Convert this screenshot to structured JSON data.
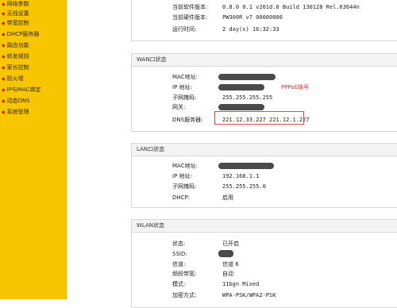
{
  "sidebar": {
    "items": [
      {
        "label": "网络参数"
      },
      {
        "label": "无线设置"
      },
      {
        "label": "带宽控制"
      },
      {
        "label": "DHCP服务器"
      },
      {
        "label": "路由功能"
      },
      {
        "label": "转发规则"
      },
      {
        "label": "家长控制"
      },
      {
        "label": "防火墙"
      },
      {
        "label": "IP与MAC绑定"
      },
      {
        "label": "动态DNS"
      },
      {
        "label": "系统管理"
      }
    ]
  },
  "top_info": {
    "rows": [
      {
        "label": "当前软件版本:",
        "value": "0.8.0 0.1 v201d.0 Build 130128 Rel.63644n"
      },
      {
        "label": "当前硬件版本:",
        "value": "PW300R v7 00000000"
      },
      {
        "label": "运行时间:",
        "value": "2 day(s) 16:32:33"
      }
    ]
  },
  "wan": {
    "title": "WAN口状态",
    "rows": [
      {
        "label": "MAC地址:",
        "value": ""
      },
      {
        "label": "IP 地址:",
        "value": ""
      },
      {
        "label": "子网掩码:",
        "value": "255.255.255.255"
      },
      {
        "label": "网关:",
        "value": ""
      },
      {
        "label": "DNS服务器:",
        "value": "221.12.33.227 221.12.1.227"
      }
    ],
    "annotation": "PPPoE拨号"
  },
  "lan": {
    "title": "LAN口状态",
    "rows": [
      {
        "label": "MAC地址:",
        "value": ""
      },
      {
        "label": "IP 地址:",
        "value": "192.168.1.1"
      },
      {
        "label": "子网掩码:",
        "value": "255.255.255.0"
      },
      {
        "label": "DHCP:",
        "value": "启用"
      }
    ]
  },
  "wlan": {
    "title": "WLAN状态",
    "rows": [
      {
        "label": "状态:",
        "value": "已开启"
      },
      {
        "label": "SSID:",
        "value": ""
      },
      {
        "label": "信道:",
        "value": "信道 6"
      },
      {
        "label": "频段带宽:",
        "value": "自动"
      },
      {
        "label": "模式:",
        "value": "11bgn Mixed"
      },
      {
        "label": "加密方式:",
        "value": "WPA-PSK/WPA2-PSK"
      }
    ]
  },
  "colors": {
    "sidebar_bg": "#f8c501",
    "annotation_red": "#e63030"
  }
}
